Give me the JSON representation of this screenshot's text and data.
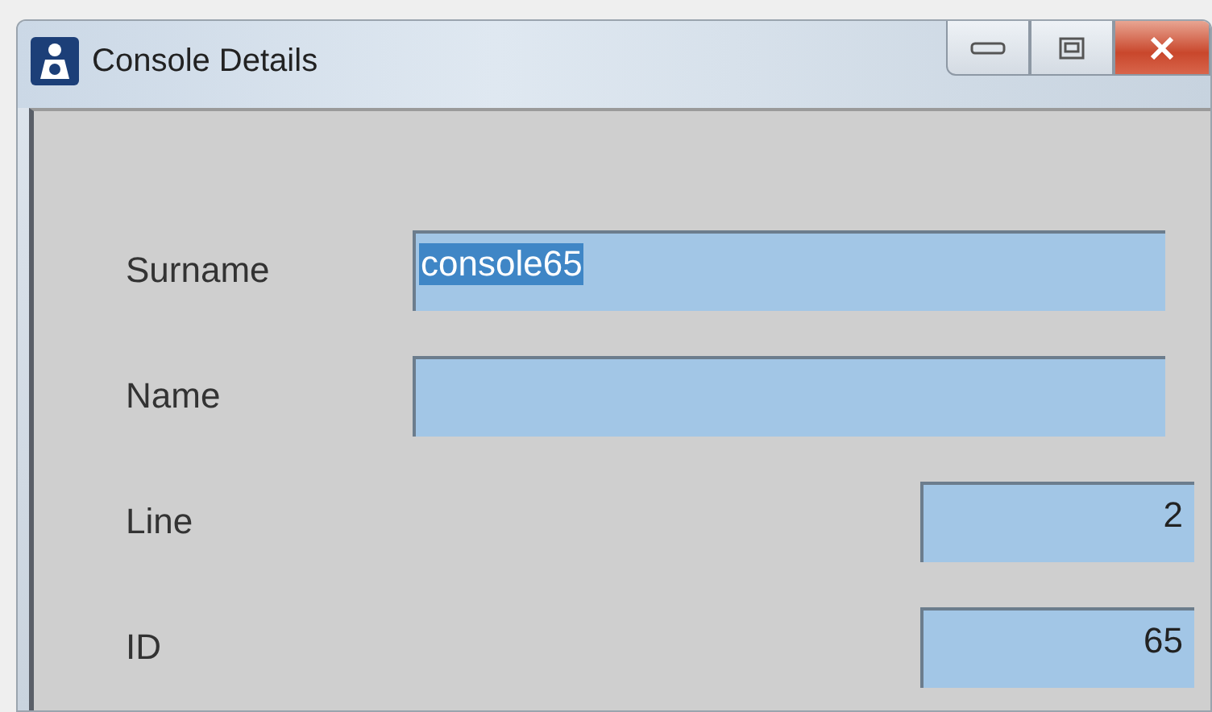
{
  "window": {
    "title": "Console Details"
  },
  "fields": [
    {
      "label": "Surname",
      "value": "console65",
      "kind": "wide",
      "text_selected": true
    },
    {
      "label": "Name",
      "kind": "wide"
    },
    {
      "label": "Line",
      "value": "2",
      "kind": "short",
      "text_selected": false
    },
    {
      "label": "ID",
      "value": "65",
      "kind": "short",
      "text_selected": false
    }
  ]
}
